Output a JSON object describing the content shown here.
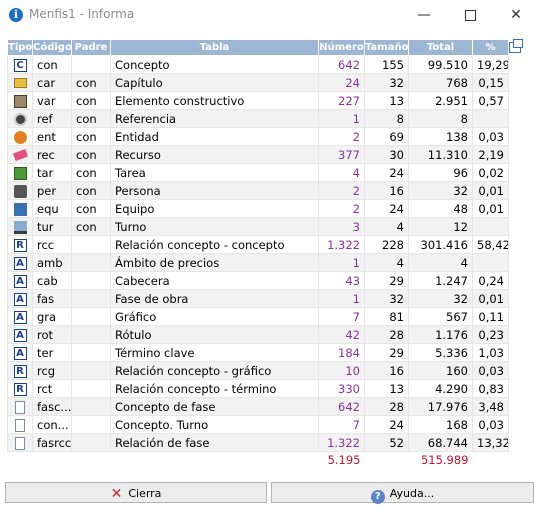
{
  "window": {
    "title": "Menfis1 - Informa",
    "minimize_glyph": "—",
    "close_glyph": "✕",
    "app_icon_glyph": "i"
  },
  "table": {
    "headers": {
      "tipo": "Tipo",
      "codigo": "Código",
      "padre": "Padre",
      "tabla": "Tabla",
      "numero": "Número",
      "tamano": "Tamaño",
      "total": "Total",
      "pct": "%"
    },
    "rows": [
      {
        "icon": "letter-c-icon",
        "glyph": "C",
        "codigo": "con",
        "padre": "",
        "tabla": "Concepto",
        "numero": "642",
        "tamano": "155",
        "total": "99.510",
        "pct": "19,29"
      },
      {
        "icon": "folder-icon",
        "glyph": "",
        "codigo": "car",
        "padre": "con",
        "tabla": "Capítulo",
        "numero": "24",
        "tamano": "32",
        "total": "768",
        "pct": "0,15"
      },
      {
        "icon": "box-icon",
        "glyph": "",
        "codigo": "var",
        "padre": "con",
        "tabla": "Elemento constructivo",
        "numero": "227",
        "tamano": "13",
        "total": "2.951",
        "pct": "0,57"
      },
      {
        "icon": "eye-icon",
        "glyph": "",
        "codigo": "ref",
        "padre": "con",
        "tabla": "Referencia",
        "numero": "1",
        "tamano": "8",
        "total": "8",
        "pct": ""
      },
      {
        "icon": "people-icon",
        "glyph": "",
        "codigo": "ent",
        "padre": "con",
        "tabla": "Entidad",
        "numero": "2",
        "tamano": "69",
        "total": "138",
        "pct": "0,03"
      },
      {
        "icon": "eraser-icon",
        "glyph": "",
        "codigo": "rec",
        "padre": "con",
        "tabla": "Recurso",
        "numero": "377",
        "tamano": "30",
        "total": "11.310",
        "pct": "2,19"
      },
      {
        "icon": "task-icon",
        "glyph": "",
        "codigo": "tar",
        "padre": "con",
        "tabla": "Tarea",
        "numero": "4",
        "tamano": "24",
        "total": "96",
        "pct": "0,02"
      },
      {
        "icon": "person-icon",
        "glyph": "",
        "codigo": "per",
        "padre": "con",
        "tabla": "Persona",
        "numero": "2",
        "tamano": "16",
        "total": "32",
        "pct": "0,01"
      },
      {
        "icon": "equipment-icon",
        "glyph": "",
        "codigo": "equ",
        "padre": "con",
        "tabla": "Equipo",
        "numero": "2",
        "tamano": "24",
        "total": "48",
        "pct": "0,01"
      },
      {
        "icon": "shift-icon",
        "glyph": "",
        "codigo": "tur",
        "padre": "con",
        "tabla": "Turno",
        "numero": "3",
        "tamano": "4",
        "total": "12",
        "pct": ""
      },
      {
        "icon": "letter-r-icon",
        "glyph": "R",
        "codigo": "rcc",
        "padre": "",
        "tabla": "Relación concepto - concepto",
        "numero": "1.322",
        "tamano": "228",
        "total": "301.416",
        "pct": "58,42"
      },
      {
        "icon": "letter-a-icon",
        "glyph": "A",
        "codigo": "amb",
        "padre": "",
        "tabla": "Ámbito de precios",
        "numero": "1",
        "tamano": "4",
        "total": "4",
        "pct": ""
      },
      {
        "icon": "letter-a-icon",
        "glyph": "A",
        "codigo": "cab",
        "padre": "",
        "tabla": "Cabecera",
        "numero": "43",
        "tamano": "29",
        "total": "1.247",
        "pct": "0,24"
      },
      {
        "icon": "letter-a-icon",
        "glyph": "A",
        "codigo": "fas",
        "padre": "",
        "tabla": "Fase de obra",
        "numero": "1",
        "tamano": "32",
        "total": "32",
        "pct": "0,01"
      },
      {
        "icon": "letter-a-icon",
        "glyph": "A",
        "codigo": "gra",
        "padre": "",
        "tabla": "Gráfico",
        "numero": "7",
        "tamano": "81",
        "total": "567",
        "pct": "0,11"
      },
      {
        "icon": "letter-a-icon",
        "glyph": "A",
        "codigo": "rot",
        "padre": "",
        "tabla": "Rótulo",
        "numero": "42",
        "tamano": "28",
        "total": "1.176",
        "pct": "0,23"
      },
      {
        "icon": "letter-a-icon",
        "glyph": "A",
        "codigo": "ter",
        "padre": "",
        "tabla": "Término clave",
        "numero": "184",
        "tamano": "29",
        "total": "5.336",
        "pct": "1,03"
      },
      {
        "icon": "letter-r-icon",
        "glyph": "R",
        "codigo": "rcg",
        "padre": "",
        "tabla": "Relación concepto - gráfico",
        "numero": "10",
        "tamano": "16",
        "total": "160",
        "pct": "0,03"
      },
      {
        "icon": "letter-r-icon",
        "glyph": "R",
        "codigo": "rct",
        "padre": "",
        "tabla": "Relación concepto - término",
        "numero": "330",
        "tamano": "13",
        "total": "4.290",
        "pct": "0,83"
      },
      {
        "icon": "page-icon",
        "glyph": "",
        "codigo": "fasc...",
        "padre": "",
        "tabla": "Concepto de fase",
        "numero": "642",
        "tamano": "28",
        "total": "17.976",
        "pct": "3,48"
      },
      {
        "icon": "page-icon",
        "glyph": "",
        "codigo": "con...",
        "padre": "",
        "tabla": "Concepto. Turno",
        "numero": "7",
        "tamano": "24",
        "total": "168",
        "pct": "0,03"
      },
      {
        "icon": "page-icon",
        "glyph": "",
        "codigo": "fasrcc",
        "padre": "",
        "tabla": "Relación de fase",
        "numero": "1.322",
        "tamano": "52",
        "total": "68.744",
        "pct": "13,32"
      }
    ],
    "totals": {
      "numero": "5.195",
      "total": "515.989"
    }
  },
  "buttons": {
    "close_label": "Cierra",
    "close_glyph": "✕",
    "help_label": "Ayuda...",
    "help_glyph": "?"
  },
  "colors": {
    "header_bg": "#9db6d3",
    "numero_text": "#8a2fa0",
    "totals_text": "#c8102e"
  }
}
